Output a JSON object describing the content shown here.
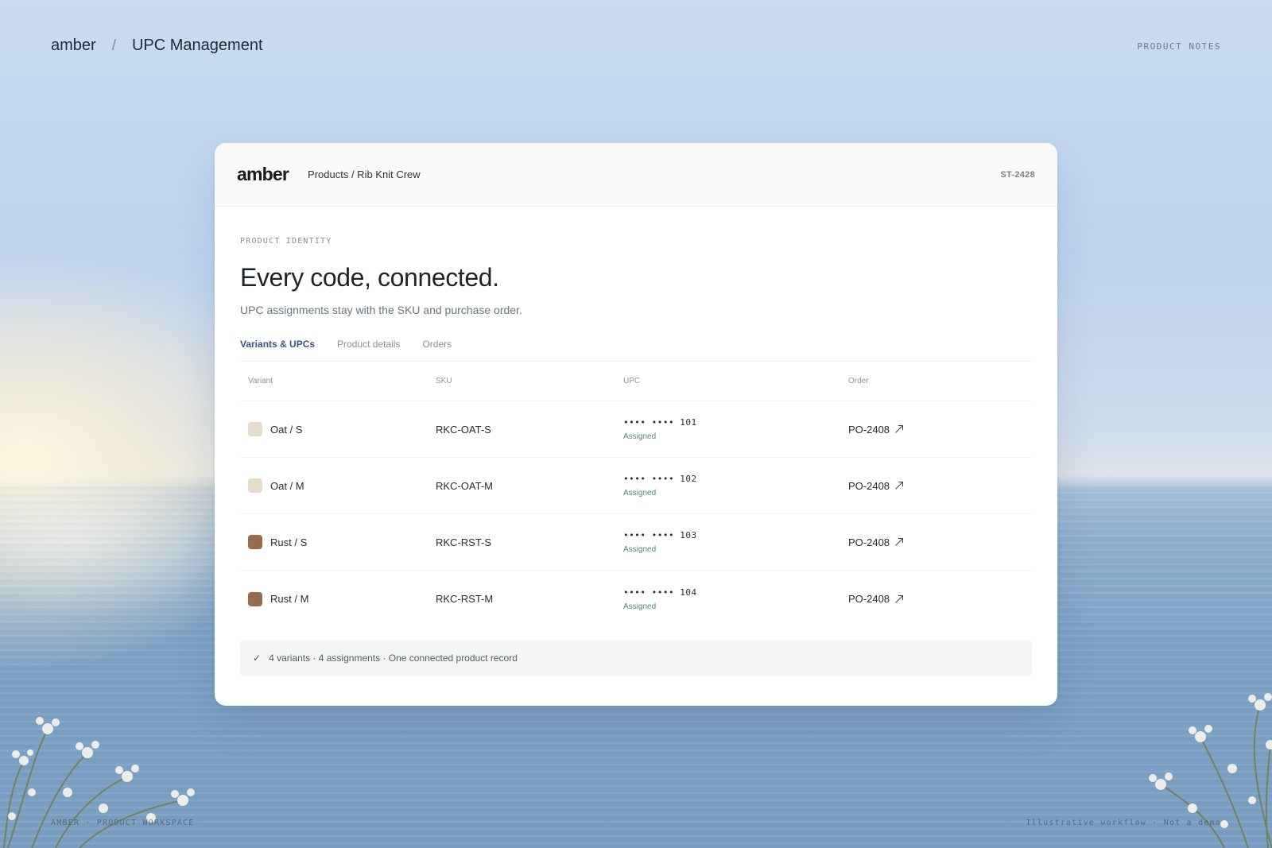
{
  "top": {
    "brand": "amber",
    "separator": "/",
    "section": "UPC Management",
    "notes_link": "PRODUCT NOTES"
  },
  "card": {
    "logo": "amber",
    "breadcrumb": "Products / Rib Knit Crew",
    "store_id": "ST-2428",
    "eyebrow": "PRODUCT IDENTITY",
    "headline": "Every code, connected.",
    "subline": "UPC assignments stay with the SKU and purchase order.",
    "tabs": [
      {
        "label": "Variants & UPCs",
        "active": true
      },
      {
        "label": "Product details",
        "active": false
      },
      {
        "label": "Orders",
        "active": false
      }
    ],
    "table": {
      "columns": [
        "Variant",
        "SKU",
        "UPC",
        "Order"
      ],
      "rows": [
        {
          "variant": "Oat / S",
          "swatch": "#e3dccb",
          "sku": "RKC-OAT-S",
          "upc": "•••• •••• 101",
          "status": "Assigned",
          "order": "PO-2408"
        },
        {
          "variant": "Oat / M",
          "swatch": "#e3dccb",
          "sku": "RKC-OAT-M",
          "upc": "•••• •••• 102",
          "status": "Assigned",
          "order": "PO-2408"
        },
        {
          "variant": "Rust / S",
          "swatch": "#9a6a4c",
          "sku": "RKC-RST-S",
          "upc": "•••• •••• 103",
          "status": "Assigned",
          "order": "PO-2408"
        },
        {
          "variant": "Rust / M",
          "swatch": "#9a6a4c",
          "sku": "RKC-RST-M",
          "upc": "•••• •••• 104",
          "status": "Assigned",
          "order": "PO-2408"
        }
      ]
    },
    "summary": {
      "check": "✓",
      "text": "4 variants · 4 assignments · One connected product record"
    }
  },
  "footer": {
    "left": "AMBER · PRODUCT WORKSPACE",
    "right": "Illustrative workflow · Not a demo"
  },
  "colors": {
    "accent_tab": "#3a5484",
    "status_green": "#4e8a6a"
  }
}
